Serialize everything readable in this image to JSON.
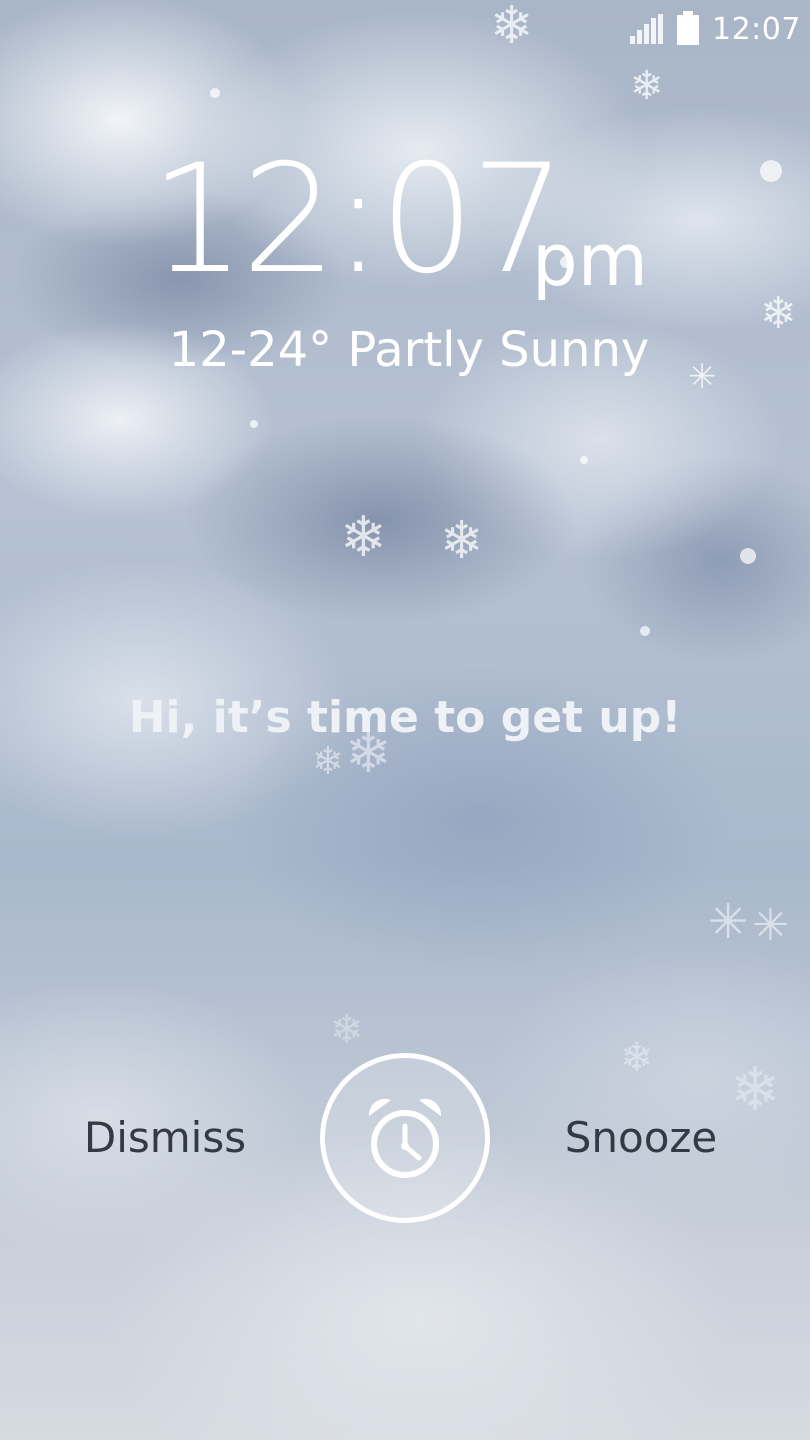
{
  "status_bar": {
    "time": "12:07",
    "signal_icon": "signal-icon",
    "battery_icon": "battery-icon"
  },
  "clock": {
    "time": "12:07",
    "ampm": "pm"
  },
  "weather": {
    "summary": "12-24° Partly Sunny"
  },
  "alarm": {
    "message": "Hi, it’s time to get up!",
    "dismiss_label": "Dismiss",
    "snooze_label": "Snooze",
    "handle_icon": "alarm-clock-icon"
  },
  "colors": {
    "text_primary": "#ffffff",
    "button_text": "#333a44",
    "ring": "#ffffff"
  }
}
